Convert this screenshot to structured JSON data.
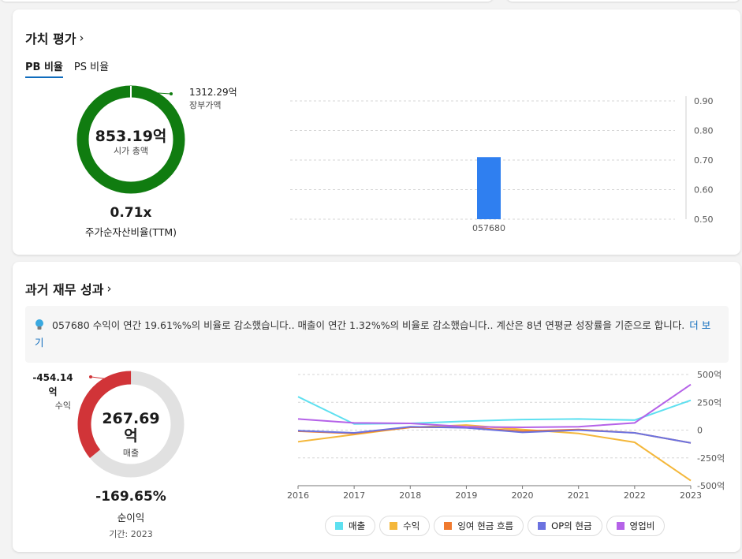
{
  "value_card": {
    "title": "가치 평가",
    "chevron": "›",
    "tabs": [
      {
        "label": "PB 비율",
        "active": true
      },
      {
        "label": "PS 비율",
        "active": false
      }
    ],
    "donut": {
      "center_value": "853.19억",
      "center_label": "시가 총액",
      "callout_value": "1312.29억",
      "callout_label": "장부가액",
      "ratio_value": "0.71x",
      "ratio_label": "주가순자산비율(TTM)",
      "color_main": "#107c10",
      "share": 0.006
    },
    "chart_data": {
      "type": "bar",
      "categories": [
        "057680"
      ],
      "values": [
        0.71
      ],
      "ylim": [
        0.5,
        0.9
      ],
      "yticks": [
        "0.90",
        "0.80",
        "0.70",
        "0.60",
        "0.50"
      ],
      "color": "#2f7ff0",
      "grid": true
    }
  },
  "perf_card": {
    "title": "과거 재무 성과",
    "chevron": "›",
    "info_icon": "lightbulb-icon",
    "info_text": "057680 수익이 연간 19.61%%의 비율로 감소했습니다.. 매출이 연간 1.32%%의 비율로 감소했습니다.. 계산은 8년 연평균 성장률을 기준으로 합니다.",
    "more_link": "더 보기",
    "donut": {
      "left_value_line1": "-454.14",
      "left_value_line2": "억",
      "left_label": "수익",
      "center_value_line1": "267.69",
      "center_value_line2": "억",
      "center_label": "매출",
      "percent": "-169.65%",
      "percent_label": "순이익",
      "period": "기간: 2023",
      "color_main": "#d13438",
      "color_rest": "#e1e1e1",
      "red_fraction": 0.36
    },
    "chart_data": {
      "type": "line",
      "x": [
        "2016",
        "2017",
        "2018",
        "2019",
        "2020",
        "2021",
        "2022",
        "2023"
      ],
      "ylim": [
        -500,
        500
      ],
      "yticks": [
        "500억",
        "250억",
        "0",
        "-250억",
        "-500억"
      ],
      "grid": true,
      "series": [
        {
          "name": "매출",
          "color": "#5ee0f0",
          "values": [
            300,
            55,
            60,
            80,
            95,
            100,
            90,
            268
          ]
        },
        {
          "name": "수익",
          "color": "#f4b73a",
          "values": [
            -105,
            -40,
            25,
            45,
            5,
            -30,
            -110,
            -454
          ]
        },
        {
          "name": "잉여 현금 흐름",
          "color": "#f07a2f",
          "values": [
            -10,
            -30,
            25,
            25,
            -10,
            5,
            -25,
            -115
          ]
        },
        {
          "name": "OP의 현금",
          "color": "#6b72e0",
          "values": [
            -5,
            -25,
            30,
            20,
            -20,
            0,
            -25,
            -115
          ]
        },
        {
          "name": "영업비",
          "color": "#b562e8",
          "values": [
            100,
            65,
            60,
            30,
            25,
            30,
            65,
            410
          ]
        }
      ]
    }
  }
}
